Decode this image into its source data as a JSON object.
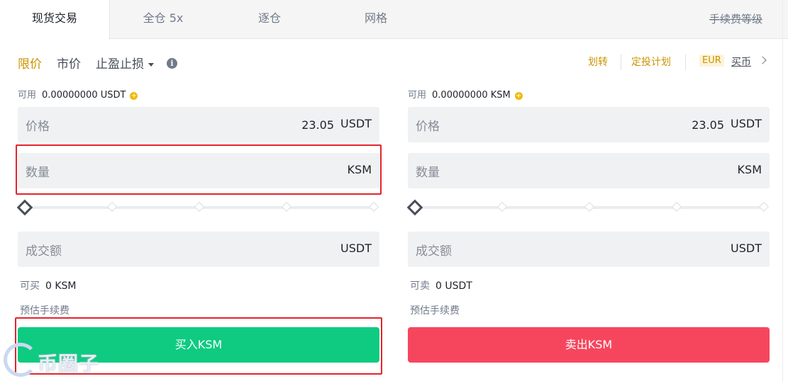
{
  "tabs": [
    {
      "label": "现货交易",
      "active": true
    },
    {
      "label": "全仓 5x",
      "active": false
    },
    {
      "label": "逐仓",
      "active": false
    },
    {
      "label": "网格",
      "active": false
    }
  ],
  "fee_level_label": "手续费等级",
  "order_types": {
    "limit": "限价",
    "market": "市价",
    "stop_limit": "止盈止损",
    "info_icon": "i"
  },
  "links": {
    "transfer": "划转",
    "recurring": "定投计划",
    "currency": "EUR",
    "buy_crypto": "买币"
  },
  "buy": {
    "available_label": "可用",
    "available_value": "0.00000000 USDT",
    "price_label": "价格",
    "price_value": "23.05",
    "price_unit": "USDT",
    "amount_label": "数量",
    "amount_unit": "KSM",
    "total_label": "成交额",
    "total_unit": "USDT",
    "max_label": "可买",
    "max_value": "0 KSM",
    "fee_label": "预估手续费",
    "button": "买入KSM",
    "slider_percent": 0
  },
  "sell": {
    "available_label": "可用",
    "available_value": "0.00000000 KSM",
    "price_label": "价格",
    "price_value": "23.05",
    "price_unit": "USDT",
    "amount_label": "数量",
    "amount_unit": "KSM",
    "total_label": "成交额",
    "total_unit": "USDT",
    "max_label": "可卖",
    "max_value": "0 USDT",
    "fee_label": "预估手续费",
    "button": "卖出KSM",
    "slider_percent": 0
  },
  "watermark": "币圈子",
  "colors": {
    "accent": "#c99400",
    "buy": "#0ecb81",
    "sell": "#f6465d",
    "highlight": "#e3242b"
  }
}
